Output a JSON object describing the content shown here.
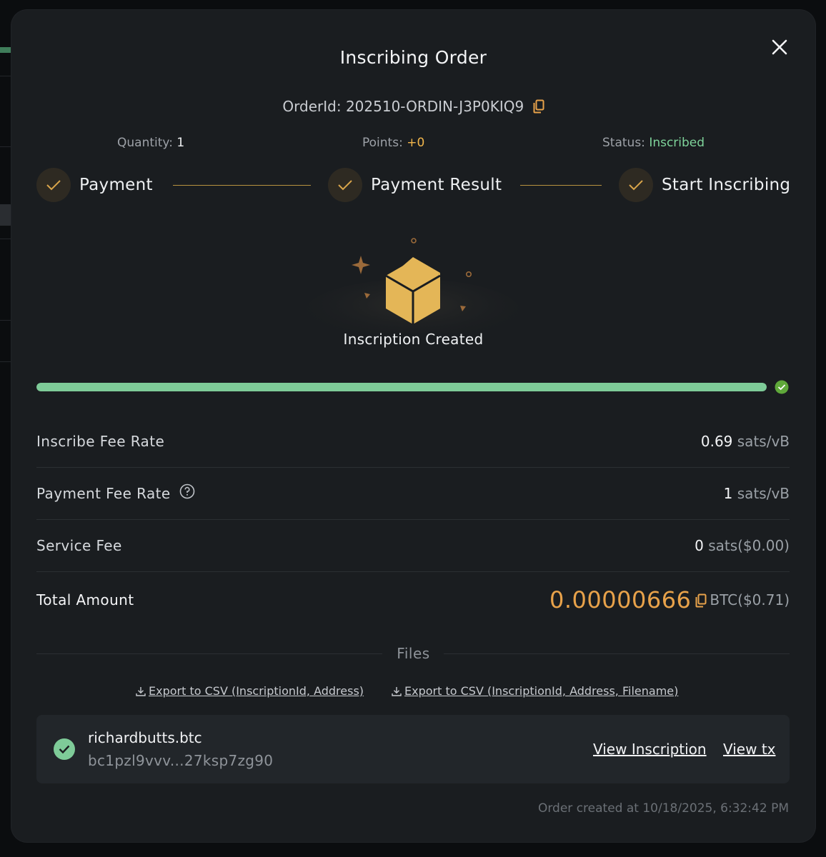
{
  "modal": {
    "title": "Inscribing Order",
    "order_id_label": "OrderId:",
    "order_id": "202510-ORDIN-J3P0KIQ9"
  },
  "meta": {
    "quantity_label": "Quantity:",
    "quantity": "1",
    "points_label": "Points:",
    "points": "+0",
    "status_label": "Status:",
    "status": "Inscribed"
  },
  "steps": [
    {
      "label": "Payment"
    },
    {
      "label": "Payment Result"
    },
    {
      "label": "Start Inscribing"
    }
  ],
  "hero": {
    "caption": "Inscription Created"
  },
  "progress": {
    "fraction": 1.0
  },
  "fees": {
    "inscribe_label": "Inscribe Fee Rate",
    "inscribe_value": "0.69",
    "inscribe_unit": "sats/vB",
    "payment_label": "Payment Fee Rate",
    "payment_value": "1",
    "payment_unit": "sats/vB",
    "service_label": "Service Fee",
    "service_value": "0",
    "service_unit": "sats($0.00)",
    "total_label": "Total Amount",
    "total_value": "0.00000666",
    "total_unit": "BTC($0.71)"
  },
  "files": {
    "section_label": "Files",
    "export1": "Export to CSV (InscriptionId, Address)",
    "export2": "Export to CSV (InscriptionId, Address, Filename)",
    "item": {
      "name": "richardbutts.btc",
      "address": "bc1pzl9vvv...27ksp7zg90",
      "view_inscription": "View Inscription",
      "view_tx": "View tx"
    }
  },
  "footer": {
    "created": "Order created at 10/18/2025, 6:32:42 PM"
  },
  "colors": {
    "accent_gold": "#e8a24a",
    "success_green": "#7ecb98",
    "points_yellow": "#f2b64b"
  }
}
